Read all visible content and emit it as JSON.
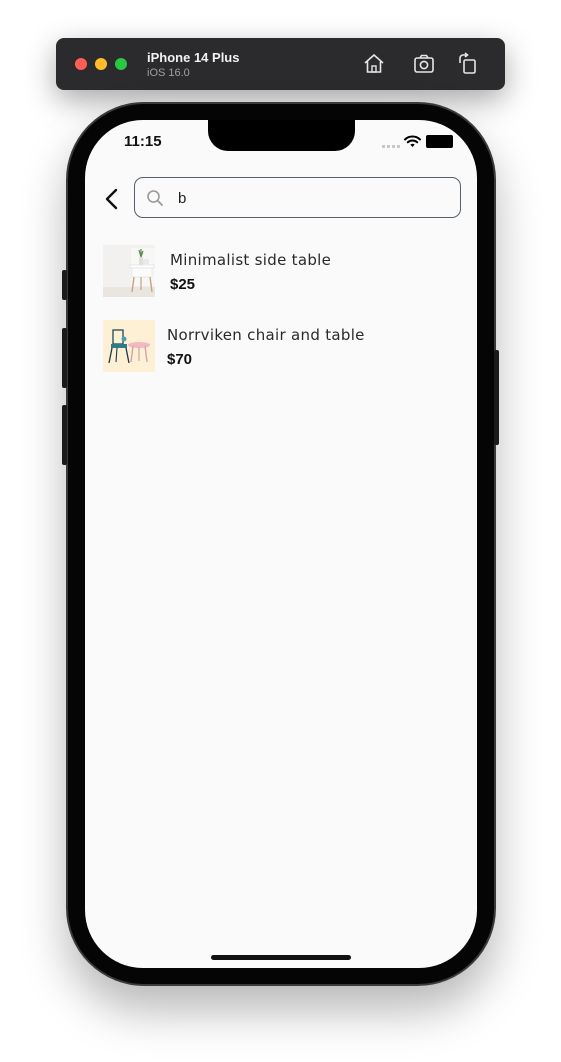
{
  "simulator": {
    "device_name": "iPhone 14 Plus",
    "os_version": "iOS 16.0",
    "buttons": [
      "home-icon",
      "screenshot-icon",
      "rotate-icon"
    ]
  },
  "status_bar": {
    "time": "11:15"
  },
  "search": {
    "query": "b"
  },
  "results": [
    {
      "name": "Minimalist side table",
      "price": "$25",
      "image": "side-table-thumbnail"
    },
    {
      "name": "Norrviken chair and table",
      "price": "$70",
      "image": "chair-table-thumbnail"
    }
  ],
  "colors": {
    "screen_bg": "#fafafa",
    "search_border": "#55606b",
    "thumb2_bg": "#fdf0d5"
  }
}
